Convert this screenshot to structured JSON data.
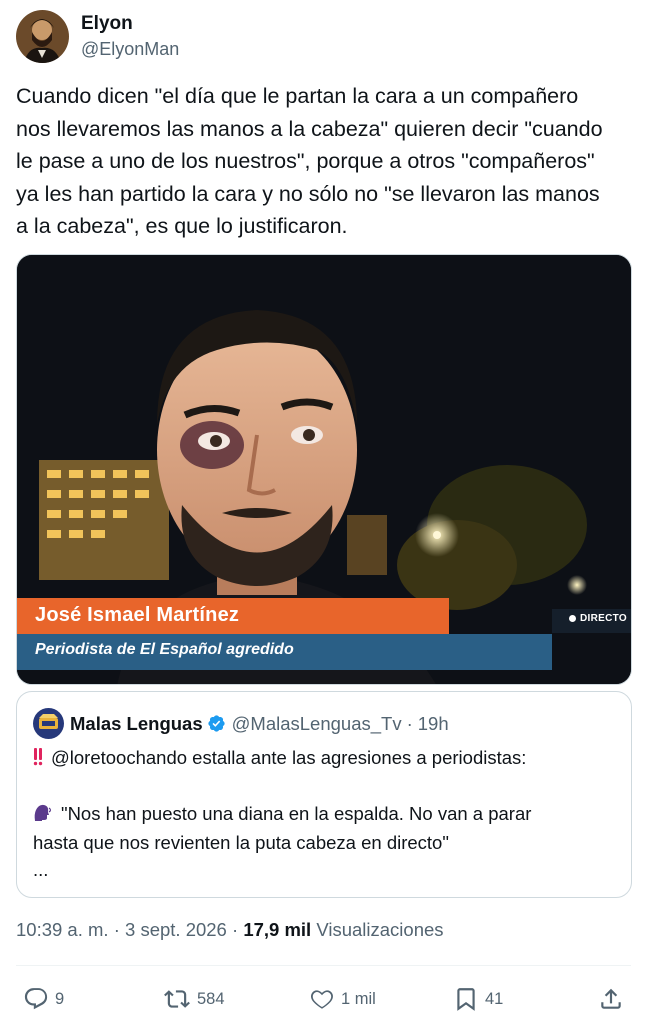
{
  "author": {
    "name": "Elyon",
    "handle": "@ElyonMan",
    "avatar_icon": "portrait-avatar"
  },
  "tweet": {
    "lines": [
      "Cuando dicen \"el día que le partan la cara a un compañero",
      "nos llevaremos las manos a la cabeza\" quieren decir \"cuando",
      "le pase a uno de los nuestros\", porque a otros \"compañeros\"",
      "ya les han partido la cara y no sólo no \"se llevaron las manos",
      "a la cabeza\", es que lo justificaron."
    ]
  },
  "media": {
    "lower_third_name": "José Ismael Martínez",
    "lower_third_subtitle": "Periodista de El Español agredido",
    "live_badge": "DIRECTO",
    "accent_orange": "#e8652b",
    "accent_blue": "#2a5f86"
  },
  "quote": {
    "name": "Malas Lenguas",
    "handle": "@MalasLenguas_Tv",
    "separator": "·",
    "time": "19h",
    "line1": "@loretoochando estalla ante las agresiones a periodistas:",
    "line2": "\"Nos han puesto una diana en la espalda. No van a parar",
    "line3": "hasta que nos revienten la puta cabeza en directo\"",
    "line4": "...",
    "verified_color": "#1d9bf0"
  },
  "meta": {
    "time": "10:39 a. m.",
    "sep1": "·",
    "date": "3 sept. 2026",
    "sep2": "·",
    "views_count": "17,9 mil",
    "views_label": "Visualizaciones"
  },
  "actions": {
    "replies": "9",
    "reposts": "584",
    "likes": "1 mil",
    "bookmarks": "41"
  }
}
